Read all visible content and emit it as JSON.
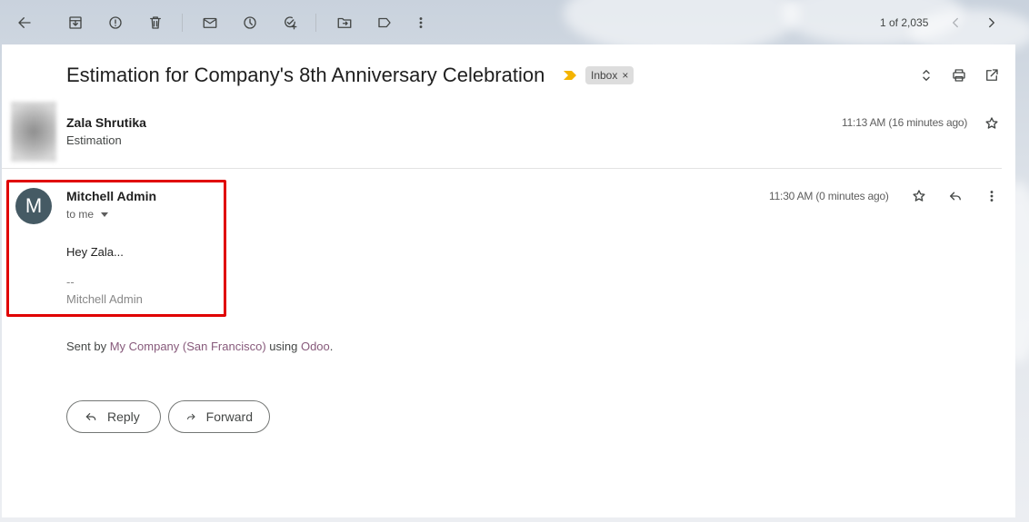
{
  "toolbar": {
    "back_icon": "arrow-left-icon",
    "archive_icon": "archive-icon",
    "report_icon": "report-spam-icon",
    "delete_icon": "trash-icon",
    "mark_unread_icon": "envelope-icon",
    "snooze_icon": "clock-icon",
    "add_task_icon": "add-task-icon",
    "move_icon": "move-to-folder-icon",
    "label_icon": "label-icon",
    "more_icon": "more-vertical-icon",
    "pager": "1 of 2,035"
  },
  "thread": {
    "subject": "Estimation for Company's 8th Anniversary Celebration",
    "label": "Inbox",
    "label_remove": "×"
  },
  "message1": {
    "sender": "Zala Shrutika",
    "snippet": "Estimation",
    "time": "11:13 AM (16 minutes ago)"
  },
  "message2": {
    "avatar_letter": "M",
    "sender": "Mitchell Admin",
    "recipient": "to me",
    "time": "11:30 AM (0 minutes ago)",
    "body": "Hey Zala...",
    "sig_dash": "--",
    "sig_name": "Mitchell Admin"
  },
  "sent_by": {
    "prefix": "Sent by ",
    "company": "My Company (San Francisco)",
    "middle": " using ",
    "app": "Odoo",
    "suffix": "."
  },
  "actions": {
    "reply": "Reply",
    "forward": "Forward"
  },
  "colors": {
    "highlight": "#e00000",
    "avatar_bg": "#455a64",
    "link": "#875a7b",
    "important": "#f4b400"
  }
}
